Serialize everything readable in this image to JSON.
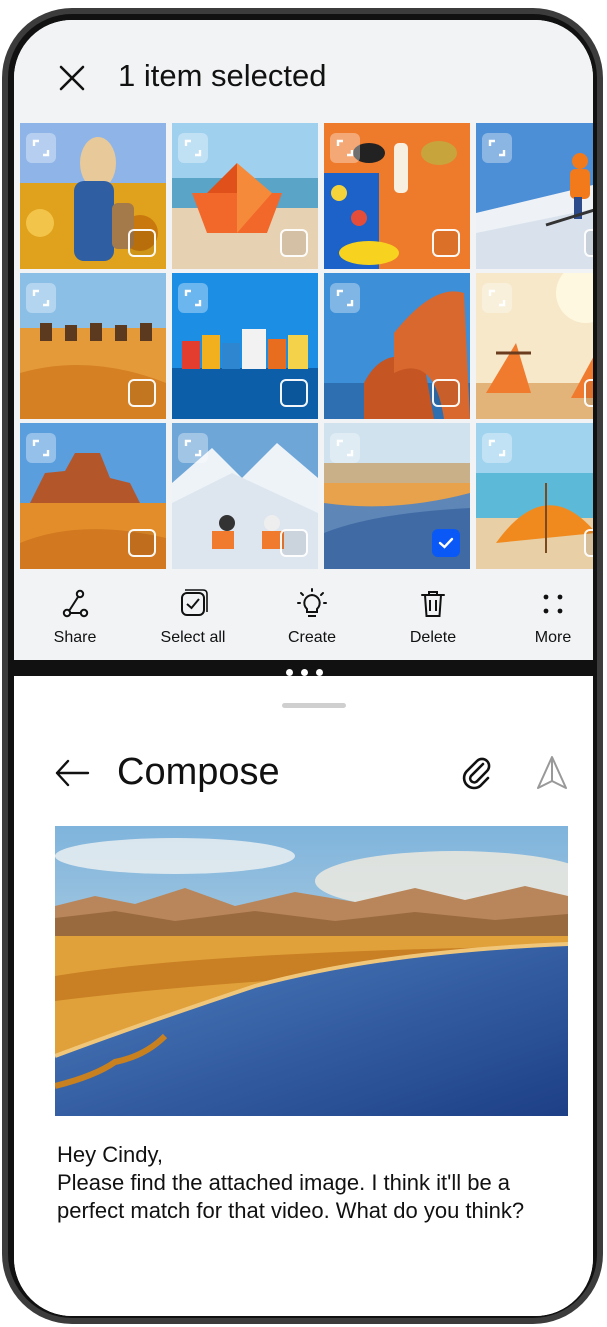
{
  "selection_header": {
    "close_icon": "close-icon",
    "title": "1 item selected"
  },
  "gallery": {
    "thumbnails": [
      {
        "subject": "woman in flower field",
        "selected": false
      },
      {
        "subject": "paper boat on beach",
        "selected": false
      },
      {
        "subject": "beach items on orange",
        "selected": false
      },
      {
        "subject": "skier on slope",
        "selected": false
      },
      {
        "subject": "camel caravan in desert",
        "selected": false
      },
      {
        "subject": "colorful harbor houses",
        "selected": false
      },
      {
        "subject": "rock arch by sea",
        "selected": false
      },
      {
        "subject": "beach chairs at sunset",
        "selected": false
      },
      {
        "subject": "desert mesa",
        "selected": false
      },
      {
        "subject": "snowy mountain chairs",
        "selected": false
      },
      {
        "subject": "lake shore landscape",
        "selected": true
      },
      {
        "subject": "orange beach umbrella",
        "selected": false
      }
    ]
  },
  "toolbar": {
    "items": [
      {
        "label": "Share",
        "icon": "share-icon"
      },
      {
        "label": "Select all",
        "icon": "select-all-icon"
      },
      {
        "label": "Create",
        "icon": "lightbulb-icon"
      },
      {
        "label": "Delete",
        "icon": "trash-icon"
      },
      {
        "label": "More",
        "icon": "more-dots-icon"
      }
    ]
  },
  "compose": {
    "back_icon": "back-arrow-icon",
    "title": "Compose",
    "attach_icon": "paperclip-icon",
    "send_icon": "send-icon",
    "greeting": "Hey Cindy,",
    "message": "Please find the attached image. I think it'll be a perfect match for that video. What do you think?"
  },
  "colors": {
    "accent": "#0a59f7",
    "gallery_bg": "#f1f3f5",
    "text": "#111111"
  }
}
